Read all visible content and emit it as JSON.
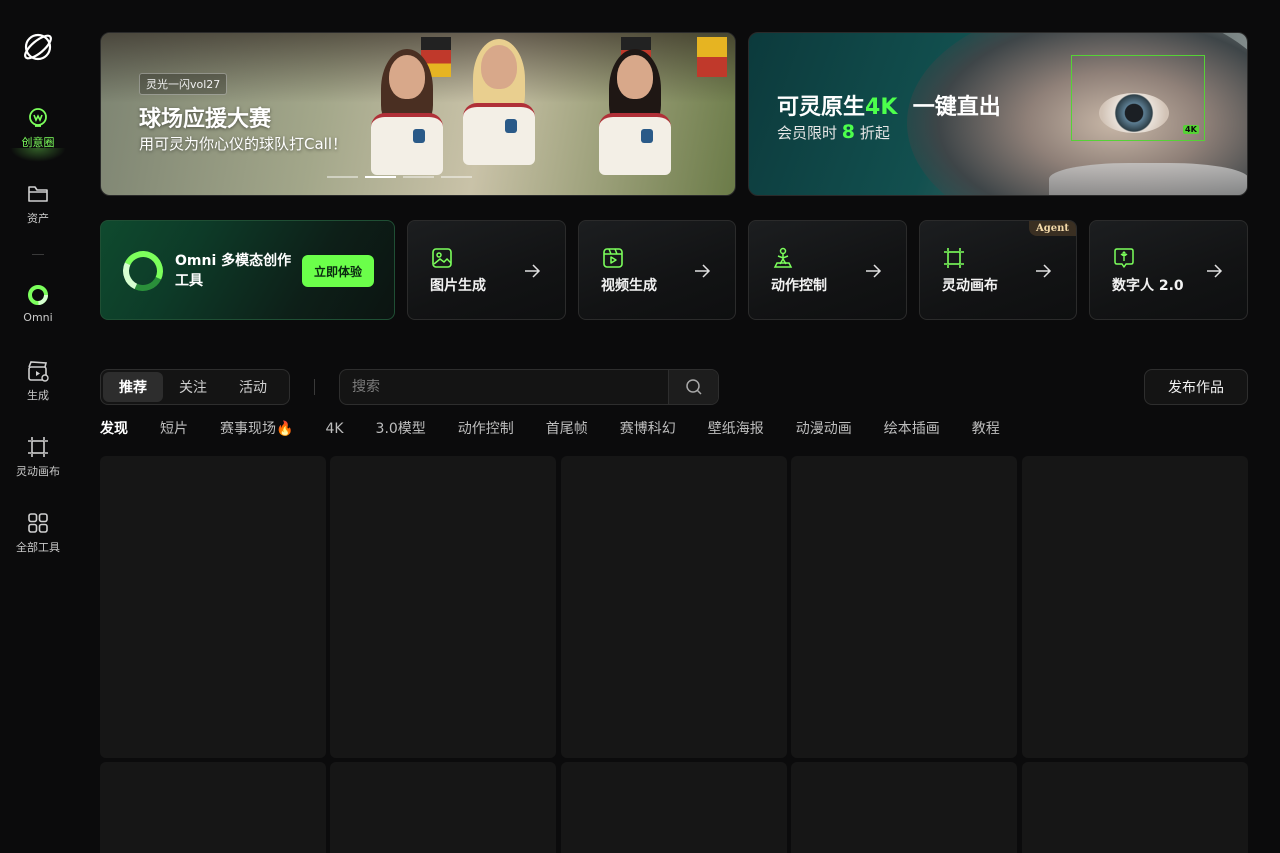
{
  "sidebar": {
    "items": [
      {
        "label": "创意圈",
        "icon": "creative-circle-icon"
      },
      {
        "label": "资产",
        "icon": "folder-icon"
      },
      {
        "label": "Omni",
        "icon": "omni-ring-icon"
      },
      {
        "label": "生成",
        "icon": "clapperboard-icon"
      },
      {
        "label": "灵动画布",
        "icon": "canvas-frame-icon"
      },
      {
        "label": "全部工具",
        "icon": "grid-icon"
      }
    ]
  },
  "banners": {
    "left": {
      "tag": "灵光一闪vol27",
      "title": "球场应援大赛",
      "subtitle": "用可灵为你心仪的球队打Call！"
    },
    "right": {
      "title_part1": "可灵原生",
      "title_highlight": "4K",
      "title_part2": "一键直出",
      "subtitle_part1": "会员限时",
      "subtitle_number": "8",
      "subtitle_part2": "折起",
      "badge": "4K"
    },
    "carousel_count": 4,
    "carousel_active": 1
  },
  "tools": {
    "omni": {
      "label": "Omni 多模态创作工具",
      "button": "立即体验"
    },
    "cards": [
      {
        "label": "图片生成",
        "icon": "image-icon"
      },
      {
        "label": "视频生成",
        "icon": "video-icon"
      },
      {
        "label": "动作控制",
        "icon": "motion-figure-icon"
      },
      {
        "label": "灵动画布",
        "icon": "canvas-frame-icon",
        "badge": "Agent"
      },
      {
        "label": "数字人 2.0",
        "icon": "digital-human-icon"
      }
    ]
  },
  "feed": {
    "segments": [
      "推荐",
      "关注",
      "活动"
    ],
    "active_segment": 0,
    "search_placeholder": "搜索",
    "publish_label": "发布作品",
    "categories": [
      "发现",
      "短片",
      "赛事现场🔥",
      "4K",
      "3.0模型",
      "动作控制",
      "首尾帧",
      "赛博科幻",
      "壁纸海报",
      "动漫动画",
      "绘本插画",
      "教程"
    ],
    "active_category": 0
  },
  "colors": {
    "background": "#0b0b0c",
    "accent": "#7cff5c",
    "highlight": "#4cff4c",
    "card": "#161616"
  }
}
